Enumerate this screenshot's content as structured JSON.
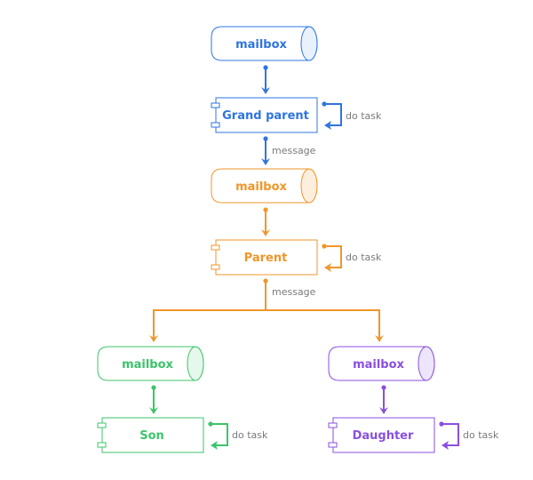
{
  "colors": {
    "blue": "#2f74e0",
    "blue_fill": "#e9f1fd",
    "orange": "#f0962a",
    "orange_fill": "#fdeede",
    "green": "#3cc46a",
    "green_fill": "#e6f8ec",
    "purple": "#8a4fe0",
    "purple_fill": "#ece5fb",
    "note": "#7a7a7a"
  },
  "nodes": {
    "gp_mailbox": {
      "label": "mailbox",
      "color": "blue"
    },
    "gp_actor": {
      "label": "Grand parent",
      "color": "blue"
    },
    "p_mailbox": {
      "label": "mailbox",
      "color": "orange"
    },
    "p_actor": {
      "label": "Parent",
      "color": "orange"
    },
    "son_mailbox": {
      "label": "mailbox",
      "color": "green"
    },
    "son_actor": {
      "label": "Son",
      "color": "green"
    },
    "dau_mailbox": {
      "label": "mailbox",
      "color": "purple"
    },
    "dau_actor": {
      "label": "Daughter",
      "color": "purple"
    }
  },
  "edges": {
    "gp_to_p_label": "message",
    "p_to_children_label": "message"
  },
  "loops": {
    "gp": "do task",
    "p": "do task",
    "son": "do task",
    "dau": "do task"
  }
}
